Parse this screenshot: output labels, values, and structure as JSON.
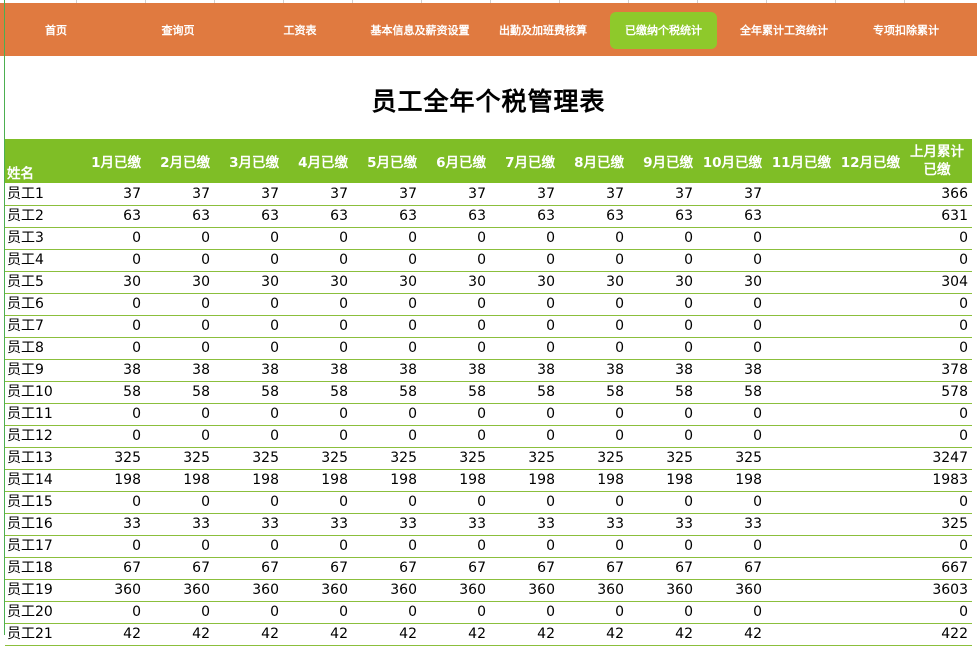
{
  "nav": {
    "items": [
      {
        "label": "首页",
        "active": false
      },
      {
        "label": "查询页",
        "active": false
      },
      {
        "label": "工资表",
        "active": false
      },
      {
        "label": "基本信息及薪资设置",
        "active": false
      },
      {
        "label": "出勤及加班费核算",
        "active": false
      },
      {
        "label": "已缴纳个税统计",
        "active": true
      },
      {
        "label": "全年累计工资统计",
        "active": false
      },
      {
        "label": "专项扣除累计",
        "active": false
      }
    ],
    "bg_color": "#e07a40",
    "active_color": "#8ec92b"
  },
  "title": "员工全年个税管理表",
  "table": {
    "header_color": "#7fbe26",
    "columns": [
      "姓名",
      "1月已缴",
      "2月已缴",
      "3月已缴",
      "4月已缴",
      "5月已缴",
      "6月已缴",
      "7月已缴",
      "8月已缴",
      "9月已缴",
      "10月已缴",
      "11月已缴",
      "12月已缴",
      "上月累计已缴"
    ],
    "rows": [
      {
        "name": "员工1",
        "monthly": [
          "37",
          "37",
          "37",
          "37",
          "37",
          "37",
          "37",
          "37",
          "37",
          "37",
          "",
          ""
        ],
        "cumulative": "366"
      },
      {
        "name": "员工2",
        "monthly": [
          "63",
          "63",
          "63",
          "63",
          "63",
          "63",
          "63",
          "63",
          "63",
          "63",
          "",
          ""
        ],
        "cumulative": "631"
      },
      {
        "name": "员工3",
        "monthly": [
          "0",
          "0",
          "0",
          "0",
          "0",
          "0",
          "0",
          "0",
          "0",
          "0",
          "",
          ""
        ],
        "cumulative": "0"
      },
      {
        "name": "员工4",
        "monthly": [
          "0",
          "0",
          "0",
          "0",
          "0",
          "0",
          "0",
          "0",
          "0",
          "0",
          "",
          ""
        ],
        "cumulative": "0"
      },
      {
        "name": "员工5",
        "monthly": [
          "30",
          "30",
          "30",
          "30",
          "30",
          "30",
          "30",
          "30",
          "30",
          "30",
          "",
          ""
        ],
        "cumulative": "304"
      },
      {
        "name": "员工6",
        "monthly": [
          "0",
          "0",
          "0",
          "0",
          "0",
          "0",
          "0",
          "0",
          "0",
          "0",
          "",
          ""
        ],
        "cumulative": "0"
      },
      {
        "name": "员工7",
        "monthly": [
          "0",
          "0",
          "0",
          "0",
          "0",
          "0",
          "0",
          "0",
          "0",
          "0",
          "",
          ""
        ],
        "cumulative": "0"
      },
      {
        "name": "员工8",
        "monthly": [
          "0",
          "0",
          "0",
          "0",
          "0",
          "0",
          "0",
          "0",
          "0",
          "0",
          "",
          ""
        ],
        "cumulative": "0"
      },
      {
        "name": "员工9",
        "monthly": [
          "38",
          "38",
          "38",
          "38",
          "38",
          "38",
          "38",
          "38",
          "38",
          "38",
          "",
          ""
        ],
        "cumulative": "378"
      },
      {
        "name": "员工10",
        "monthly": [
          "58",
          "58",
          "58",
          "58",
          "58",
          "58",
          "58",
          "58",
          "58",
          "58",
          "",
          ""
        ],
        "cumulative": "578"
      },
      {
        "name": "员工11",
        "monthly": [
          "0",
          "0",
          "0",
          "0",
          "0",
          "0",
          "0",
          "0",
          "0",
          "0",
          "",
          ""
        ],
        "cumulative": "0"
      },
      {
        "name": "员工12",
        "monthly": [
          "0",
          "0",
          "0",
          "0",
          "0",
          "0",
          "0",
          "0",
          "0",
          "0",
          "",
          ""
        ],
        "cumulative": "0"
      },
      {
        "name": "员工13",
        "monthly": [
          "325",
          "325",
          "325",
          "325",
          "325",
          "325",
          "325",
          "325",
          "325",
          "325",
          "",
          ""
        ],
        "cumulative": "3247"
      },
      {
        "name": "员工14",
        "monthly": [
          "198",
          "198",
          "198",
          "198",
          "198",
          "198",
          "198",
          "198",
          "198",
          "198",
          "",
          ""
        ],
        "cumulative": "1983"
      },
      {
        "name": "员工15",
        "monthly": [
          "0",
          "0",
          "0",
          "0",
          "0",
          "0",
          "0",
          "0",
          "0",
          "0",
          "",
          ""
        ],
        "cumulative": "0"
      },
      {
        "name": "员工16",
        "monthly": [
          "33",
          "33",
          "33",
          "33",
          "33",
          "33",
          "33",
          "33",
          "33",
          "33",
          "",
          ""
        ],
        "cumulative": "325"
      },
      {
        "name": "员工17",
        "monthly": [
          "0",
          "0",
          "0",
          "0",
          "0",
          "0",
          "0",
          "0",
          "0",
          "0",
          "",
          ""
        ],
        "cumulative": "0"
      },
      {
        "name": "员工18",
        "monthly": [
          "67",
          "67",
          "67",
          "67",
          "67",
          "67",
          "67",
          "67",
          "67",
          "67",
          "",
          ""
        ],
        "cumulative": "667"
      },
      {
        "name": "员工19",
        "monthly": [
          "360",
          "360",
          "360",
          "360",
          "360",
          "360",
          "360",
          "360",
          "360",
          "360",
          "",
          ""
        ],
        "cumulative": "3603"
      },
      {
        "name": "员工20",
        "monthly": [
          "0",
          "0",
          "0",
          "0",
          "0",
          "0",
          "0",
          "0",
          "0",
          "0",
          "",
          ""
        ],
        "cumulative": "0"
      },
      {
        "name": "员工21",
        "monthly": [
          "42",
          "42",
          "42",
          "42",
          "42",
          "42",
          "42",
          "42",
          "42",
          "42",
          "",
          ""
        ],
        "cumulative": "422"
      }
    ]
  }
}
